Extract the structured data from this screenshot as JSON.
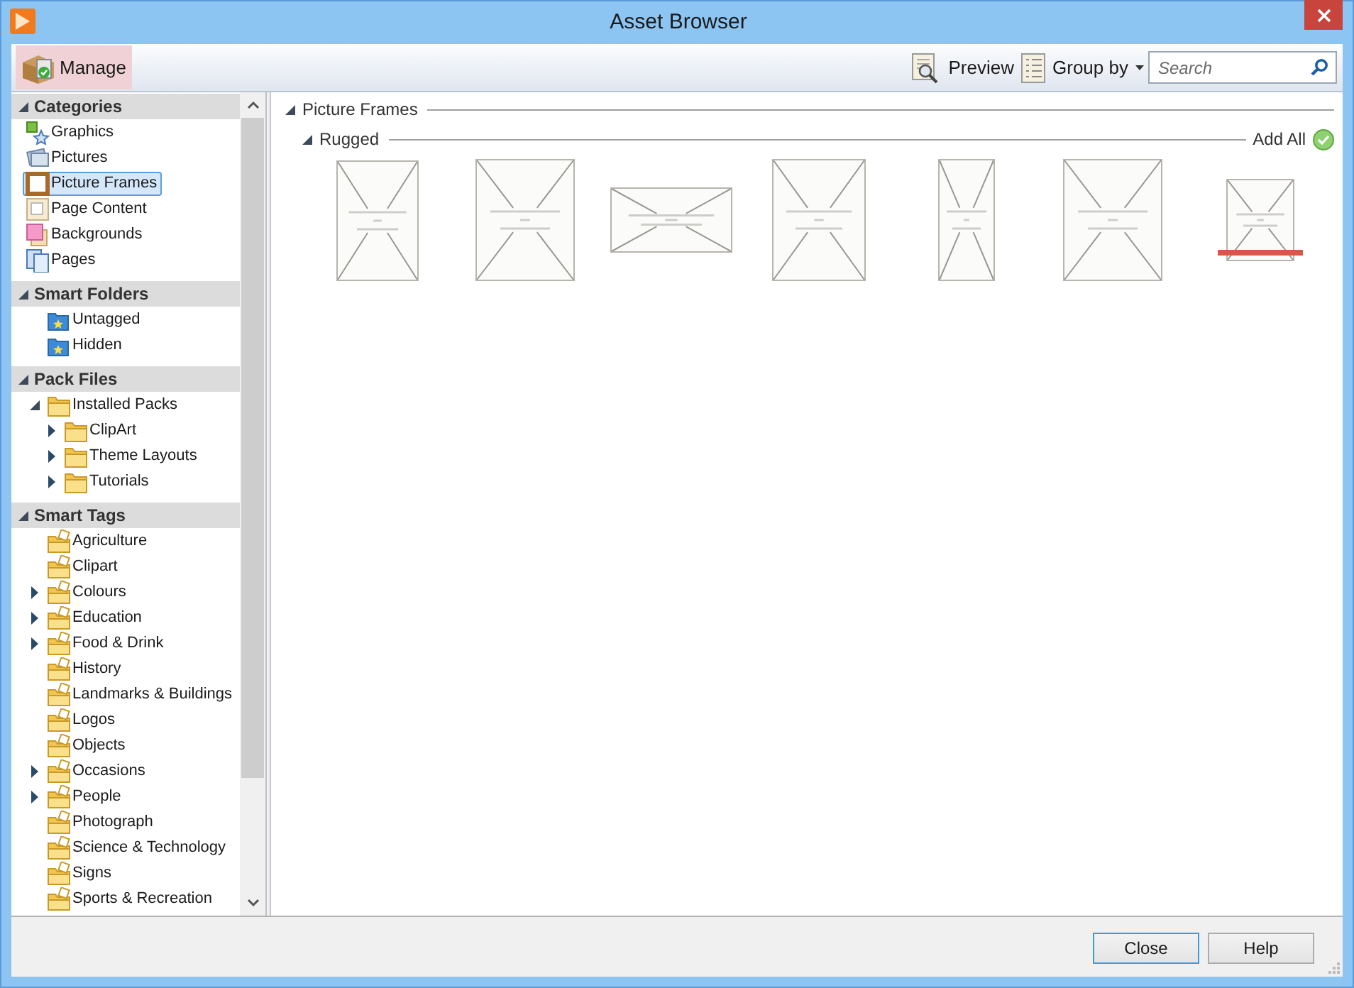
{
  "window": {
    "title": "Asset Browser"
  },
  "toolbar": {
    "manage": {
      "label": "Manage",
      "highlighted": true
    },
    "preview": {
      "label": "Preview"
    },
    "group_by": {
      "label": "Group by"
    },
    "search": {
      "placeholder": "Search"
    }
  },
  "sidebar": {
    "sections": [
      {
        "title": "Categories",
        "kind": "flat",
        "expanded": true,
        "items": [
          {
            "label": "Graphics",
            "kind": "graphics",
            "selected": false
          },
          {
            "label": "Pictures",
            "kind": "pictures",
            "selected": false
          },
          {
            "label": "Picture Frames",
            "kind": "frame",
            "selected": true
          },
          {
            "label": "Page Content",
            "kind": "content",
            "selected": false
          },
          {
            "label": "Backgrounds",
            "kind": "backgrounds",
            "selected": false
          },
          {
            "label": "Pages",
            "kind": "pages",
            "selected": false
          }
        ]
      },
      {
        "title": "Smart Folders",
        "kind": "tree",
        "expanded": true,
        "items": [
          {
            "label": "Untagged",
            "kind": "smartfolder",
            "selected": false
          },
          {
            "label": "Hidden",
            "kind": "smartfolder",
            "selected": false
          }
        ]
      },
      {
        "title": "Pack Files",
        "kind": "tree",
        "expanded": true,
        "items": [
          {
            "label": "Installed Packs",
            "kind": "folder",
            "expanded": true,
            "selected": false,
            "children": [
              {
                "label": "ClipArt",
                "kind": "folder",
                "expanded": false,
                "selected": false
              },
              {
                "label": "Theme Layouts",
                "kind": "folder",
                "expanded": false,
                "selected": false
              },
              {
                "label": "Tutorials",
                "kind": "folder",
                "expanded": false,
                "selected": false
              }
            ]
          }
        ]
      },
      {
        "title": "Smart Tags",
        "kind": "tree",
        "expanded": true,
        "items": [
          {
            "label": "Agriculture",
            "kind": "tagfolder",
            "selected": false
          },
          {
            "label": "Clipart",
            "kind": "tagfolder",
            "selected": false
          },
          {
            "label": "Colours",
            "kind": "tagfolder",
            "expanded": false,
            "selected": false
          },
          {
            "label": "Education",
            "kind": "tagfolder",
            "expanded": false,
            "selected": false
          },
          {
            "label": "Food & Drink",
            "kind": "tagfolder",
            "expanded": false,
            "selected": false
          },
          {
            "label": "History",
            "kind": "tagfolder",
            "selected": false
          },
          {
            "label": "Landmarks & Buildings",
            "kind": "tagfolder",
            "selected": false
          },
          {
            "label": "Logos",
            "kind": "tagfolder",
            "selected": false
          },
          {
            "label": "Objects",
            "kind": "tagfolder",
            "selected": false
          },
          {
            "label": "Occasions",
            "kind": "tagfolder",
            "expanded": false,
            "selected": false
          },
          {
            "label": "People",
            "kind": "tagfolder",
            "expanded": false,
            "selected": false
          },
          {
            "label": "Photograph",
            "kind": "tagfolder",
            "selected": false
          },
          {
            "label": "Science & Technology",
            "kind": "tagfolder",
            "selected": false
          },
          {
            "label": "Signs",
            "kind": "tagfolder",
            "selected": false
          },
          {
            "label": "Sports & Recreation",
            "kind": "tagfolder",
            "selected": false
          }
        ]
      }
    ]
  },
  "content": {
    "groups": [
      {
        "title": "Picture Frames",
        "expanded": true,
        "subgroups": [
          {
            "title": "Rugged",
            "expanded": true,
            "action": "Add All",
            "thumbnails": [
              {
                "kind": "tall",
                "ribbon": false
              },
              {
                "kind": "portrait",
                "ribbon": false
              },
              {
                "kind": "landscape",
                "ribbon": false
              },
              {
                "kind": "broad",
                "ribbon": false
              },
              {
                "kind": "narrow",
                "ribbon": false
              },
              {
                "kind": "portrait",
                "ribbon": false
              },
              {
                "kind": "square",
                "ribbon": true
              }
            ]
          }
        ]
      }
    ]
  },
  "buttons": [
    {
      "label": "Close",
      "default": true
    },
    {
      "label": "Help",
      "default": false
    }
  ]
}
